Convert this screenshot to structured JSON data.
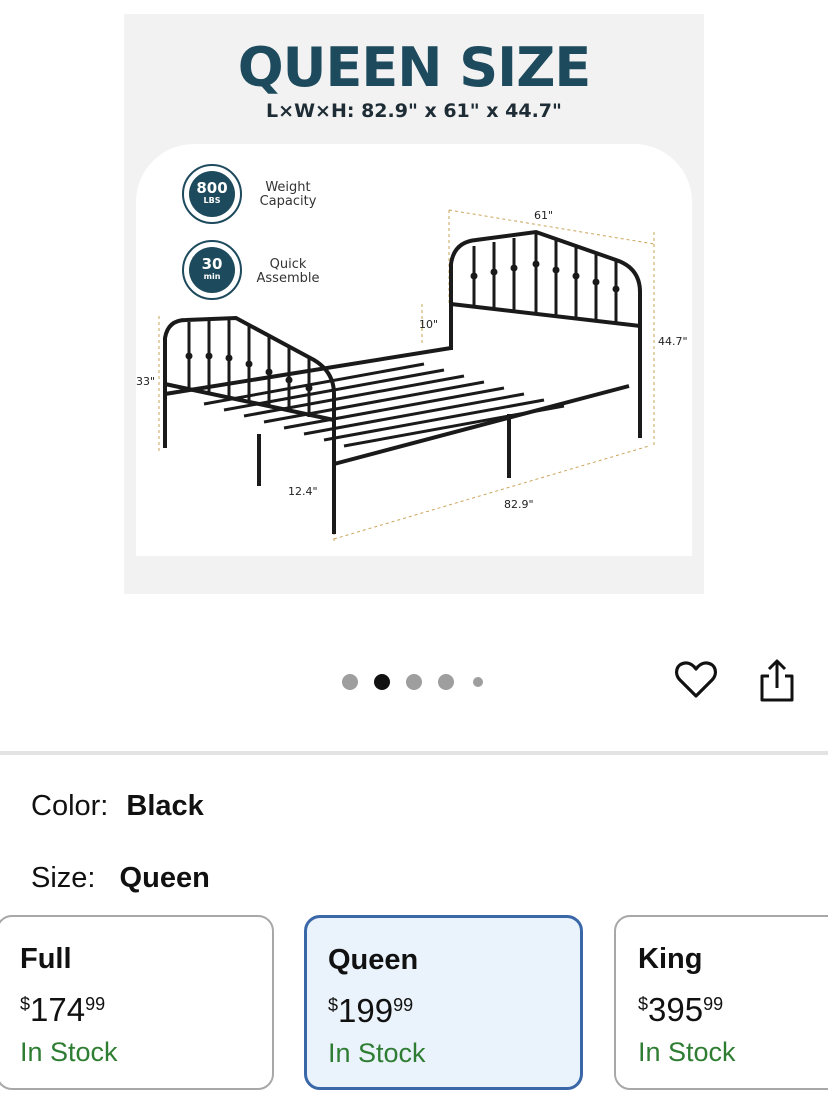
{
  "product_image": {
    "title": "QUEEN SIZE",
    "subtitle": "L×W×H: 82.9\" x 61\" x 44.7\"",
    "badges": [
      {
        "value": "800",
        "unit": "LBS",
        "label": "Weight Capacity"
      },
      {
        "value": "30",
        "unit": "min",
        "label": "Quick Assemble"
      }
    ],
    "dimensions": {
      "width": "61\"",
      "height": "44.7\"",
      "clearance": "10\"",
      "footboard": "33\"",
      "leg": "12.4\"",
      "length": "82.9\""
    }
  },
  "carousel": {
    "total_dots": 5,
    "active_index": 1
  },
  "actions": {
    "favorite_icon": "heart-outline-icon",
    "share_icon": "share-icon"
  },
  "color_option": {
    "label": "Color:",
    "value": "Black"
  },
  "size_option": {
    "label": "Size:",
    "value": "Queen"
  },
  "size_cards": [
    {
      "name": "Full",
      "currency": "$",
      "price_whole": "174",
      "price_cents": "99",
      "stock": "In Stock",
      "selected": false
    },
    {
      "name": "Queen",
      "currency": "$",
      "price_whole": "199",
      "price_cents": "99",
      "stock": "In Stock",
      "selected": true
    },
    {
      "name": "King",
      "currency": "$",
      "price_whole": "395",
      "price_cents": "99",
      "stock": "In Stock",
      "selected": false
    }
  ],
  "colors": {
    "brand_teal": "#1d4a5c",
    "selected_border": "#3a67a8",
    "selected_bg": "#eaf3fc",
    "in_stock": "#2e7d32"
  }
}
